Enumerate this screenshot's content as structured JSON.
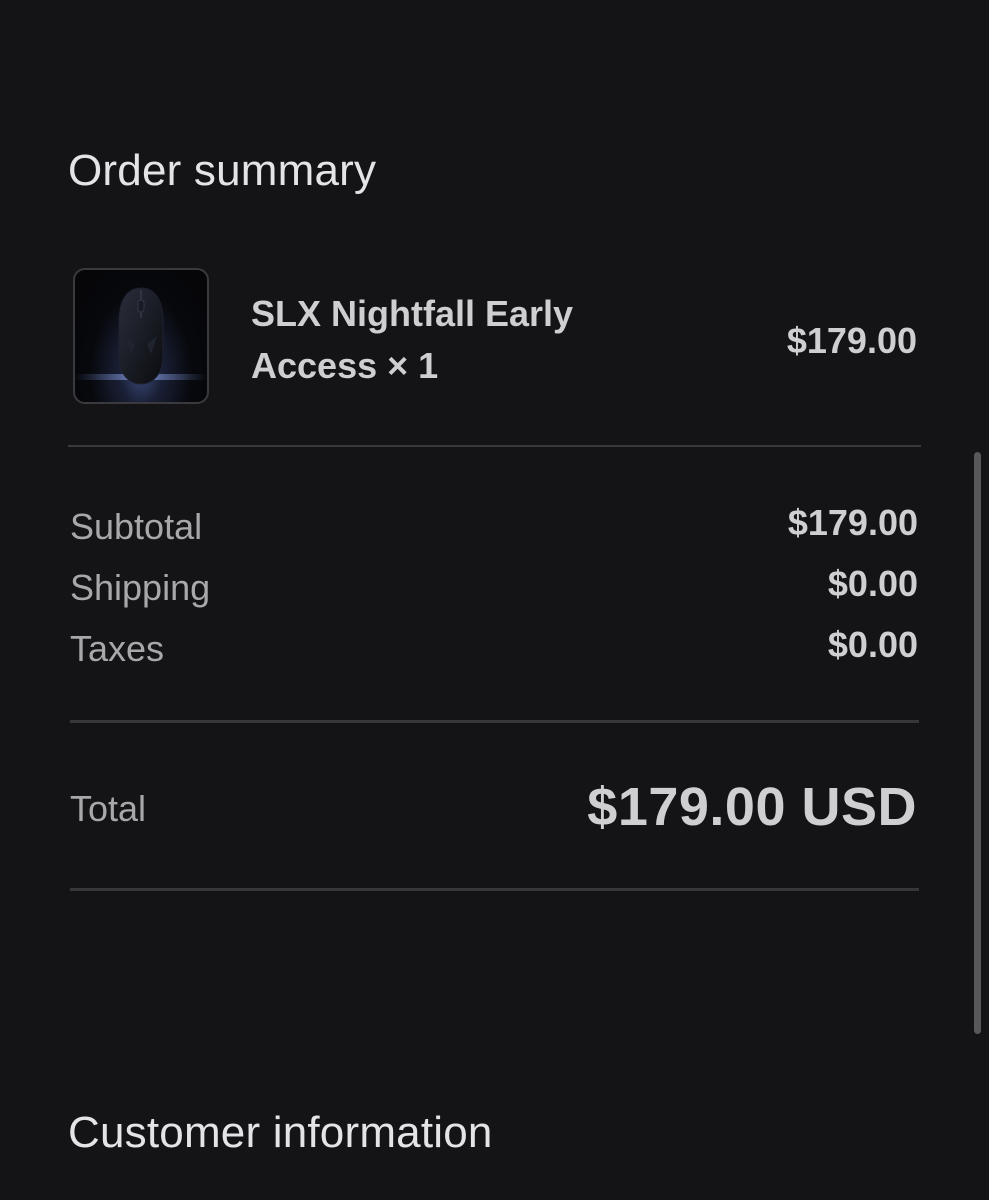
{
  "order_summary": {
    "title": "Order summary",
    "item": {
      "name": "SLX Nightfall Early Access × 1",
      "price": "$179.00",
      "thumbnail": "mouse-product-image"
    },
    "subtotal_label": "Subtotal",
    "subtotal_value": "$179.00",
    "shipping_label": "Shipping",
    "shipping_value": "$0.00",
    "taxes_label": "Taxes",
    "taxes_value": "$0.00",
    "total_label": "Total",
    "total_value": "$179.00 USD"
  },
  "customer_information": {
    "title": "Customer information"
  },
  "colors": {
    "background": "#141416",
    "text_primary": "#cfcfd2",
    "text_secondary": "#a8a8ac",
    "divider": "#3a3a3e"
  }
}
